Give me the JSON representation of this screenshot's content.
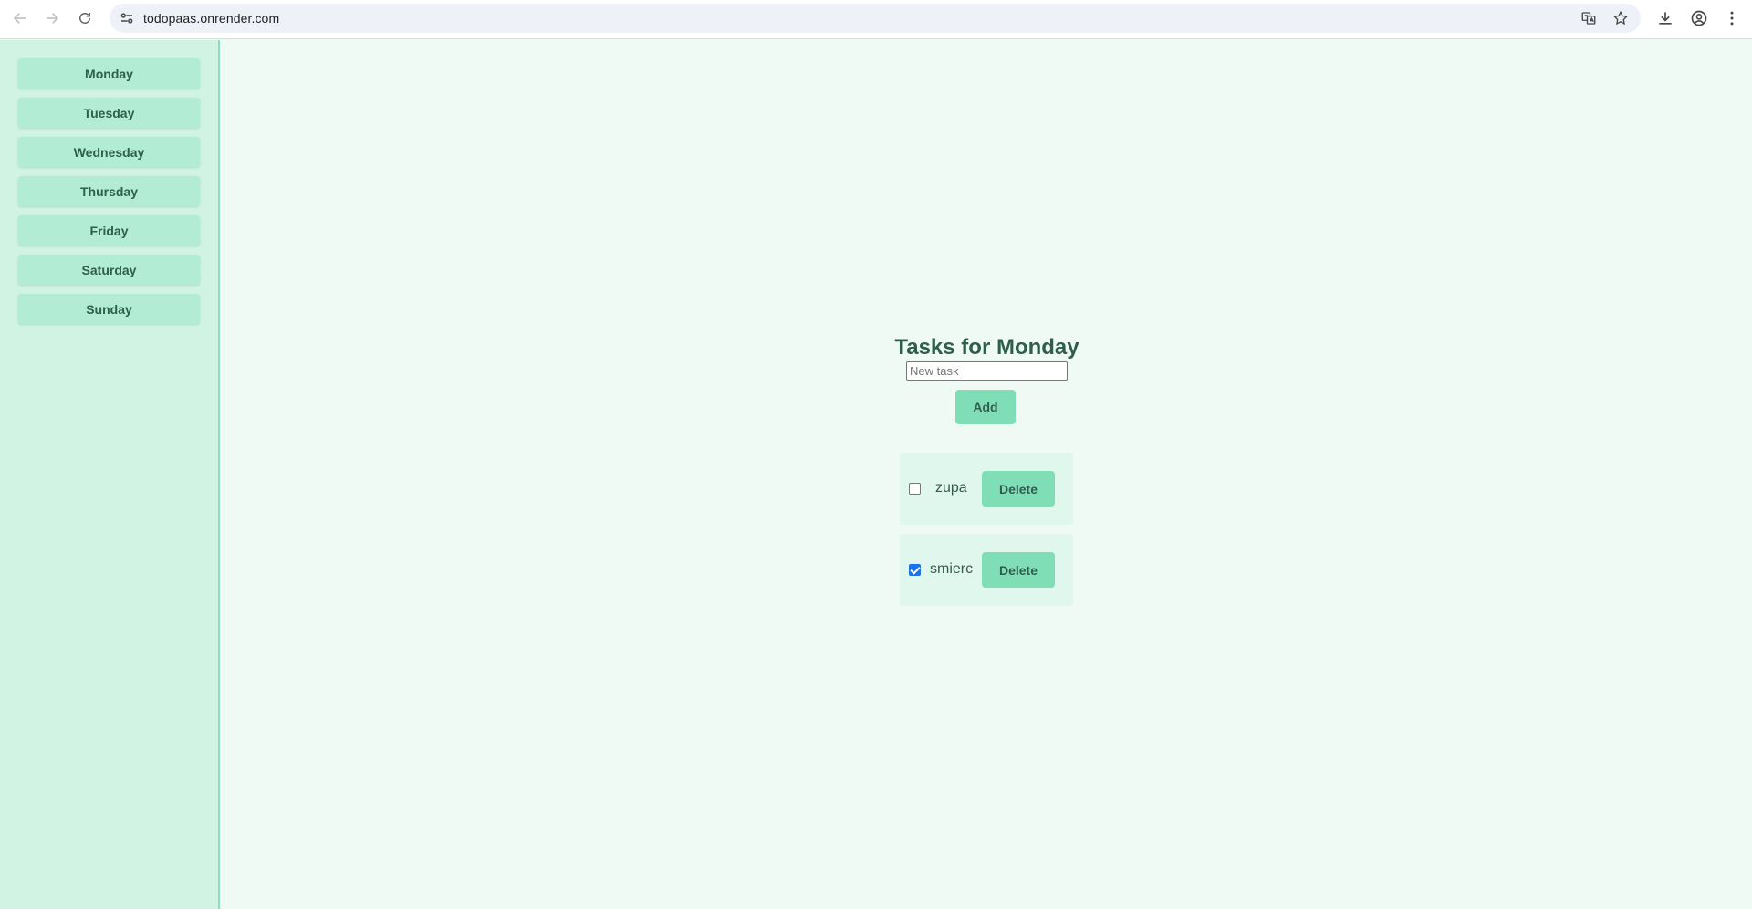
{
  "browser": {
    "url": "todopaas.onrender.com"
  },
  "sidebar": {
    "days": [
      "Monday",
      "Tuesday",
      "Wednesday",
      "Thursday",
      "Friday",
      "Saturday",
      "Sunday"
    ]
  },
  "main": {
    "title": "Tasks for Monday",
    "input_placeholder": "New task",
    "add_label": "Add",
    "tasks": [
      {
        "text": "zupa",
        "done": false,
        "delete_label": "Delete"
      },
      {
        "text": "smierc",
        "done": true,
        "delete_label": "Delete"
      }
    ]
  },
  "colors": {
    "sidebar_bg": "#d1f3e4",
    "button_bg": "#b3ecd4",
    "accent": "#80deb6",
    "text": "#2e5e4e",
    "main_bg": "#f0faf5"
  }
}
